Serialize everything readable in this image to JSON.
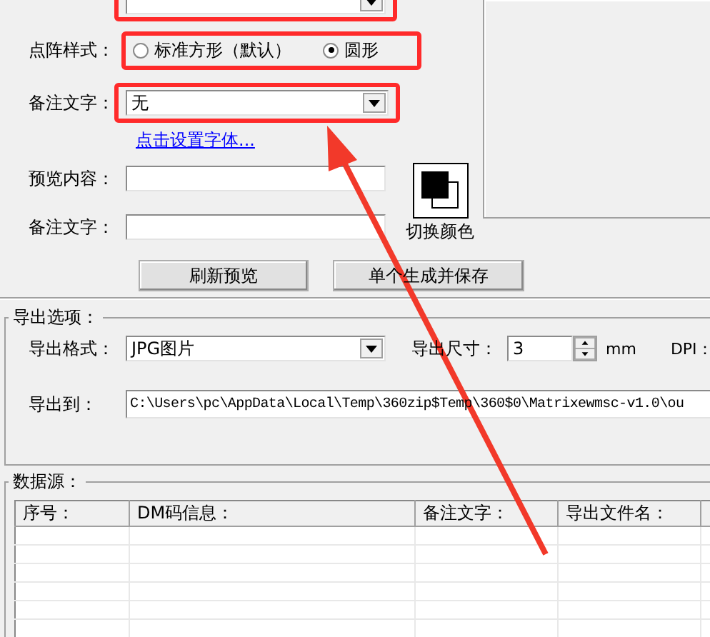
{
  "form": {
    "symbol_size": {
      "highlighted": true
    },
    "dot_style": {
      "label": "点阵样式：",
      "highlighted": true,
      "options": [
        {
          "label": "标准方形（默认）",
          "selected": false
        },
        {
          "label": "圆形",
          "selected": true
        }
      ]
    },
    "remark_combo": {
      "label": "备注文字：",
      "value": "无",
      "highlighted": true
    },
    "font_link": "点击设置字体...",
    "preview_content": {
      "label": "预览内容："
    },
    "remark_text": {
      "label": "备注文字："
    },
    "color_button": {
      "label": "切换颜色"
    },
    "buttons": [
      "刷新预览",
      "单个生成并保存"
    ]
  },
  "export": {
    "title": "导出选项：",
    "format": {
      "label": "导出格式：",
      "value": "JPG图片"
    },
    "size": {
      "label": "导出尺寸：",
      "value": "3",
      "unit": "mm"
    },
    "dpi_label": "DPI：",
    "path": {
      "label": "导出到：",
      "value": "C:\\Users\\pc\\AppData\\Local\\Temp\\360zip$Temp\\360$0\\Matrixewmsc-v1.0\\ou"
    }
  },
  "data_source": {
    "title": "数据源：",
    "columns": [
      "序号：",
      "DM码信息：",
      "备注文字：",
      "导出文件名："
    ]
  },
  "pointer_arrow": {
    "shown": true
  }
}
